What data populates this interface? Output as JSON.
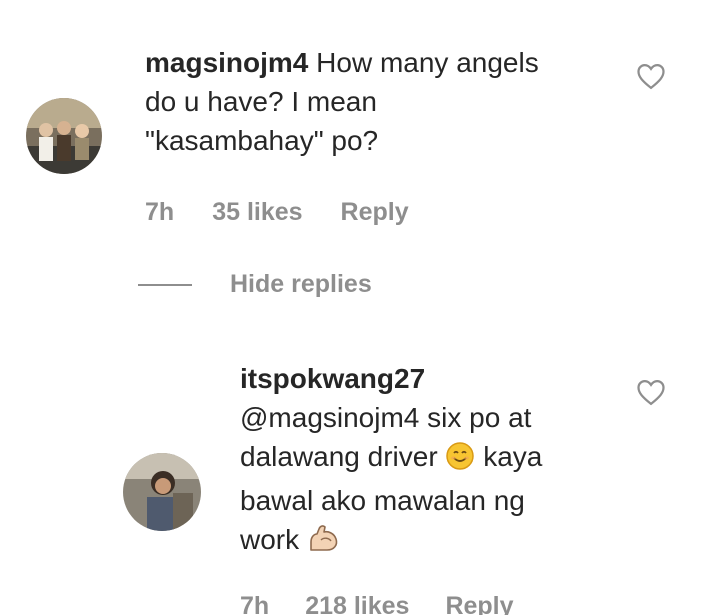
{
  "comment": {
    "username": "magsinojm4",
    "text_line1": "How many angels",
    "text_line2": "do u have? I mean",
    "text_line3": "\"kasambahay\" po?",
    "time": "7h",
    "likes": "35 likes",
    "reply_label": "Reply"
  },
  "hide_replies_label": "Hide replies",
  "reply": {
    "username": "itspokwang27",
    "text_line1": "@magsinojm4 six po at",
    "text_line2a": "dalawang driver",
    "text_line2b": "kaya",
    "text_line3": "bawal ako mawalan ng",
    "text_line4": "work",
    "time": "7h",
    "likes": "218 likes",
    "reply_label": "Reply"
  },
  "icons": {
    "like": "heart-outline-icon",
    "smile": "smiling-face-emoji",
    "flex": "flexed-biceps-emoji"
  },
  "colors": {
    "text": "#262626",
    "secondary": "#8e8e8e",
    "background": "#ffffff"
  }
}
